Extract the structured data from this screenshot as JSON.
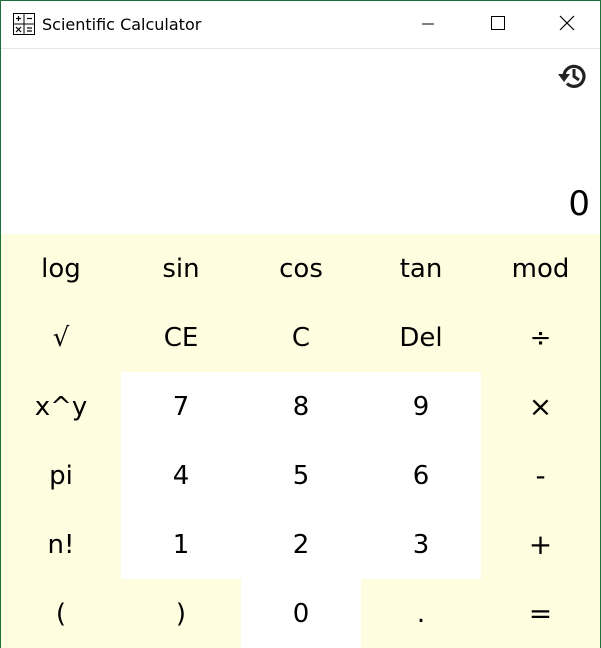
{
  "window": {
    "title": "Scientific Calculator"
  },
  "display": {
    "value": "0"
  },
  "icons": {
    "app": "calculator-icon",
    "history": "history-icon",
    "minimize": "minimize-icon",
    "maximize": "maximize-icon",
    "close": "close-icon"
  },
  "colors": {
    "keypad_bg": "#fffde0",
    "number_key_bg": "#ffffff",
    "window_border": "#1e6f3a"
  },
  "keys": {
    "r1": [
      "log",
      "sin",
      "cos",
      "tan",
      "mod"
    ],
    "r2": [
      "√",
      "CE",
      "C",
      "Del",
      "÷"
    ],
    "r3": [
      "x^y",
      "7",
      "8",
      "9",
      "×"
    ],
    "r4": [
      "pi",
      "4",
      "5",
      "6",
      "-"
    ],
    "r5": [
      "n!",
      "1",
      "2",
      "3",
      "+"
    ],
    "r6": [
      "(",
      ")",
      "0",
      ".",
      "="
    ]
  }
}
